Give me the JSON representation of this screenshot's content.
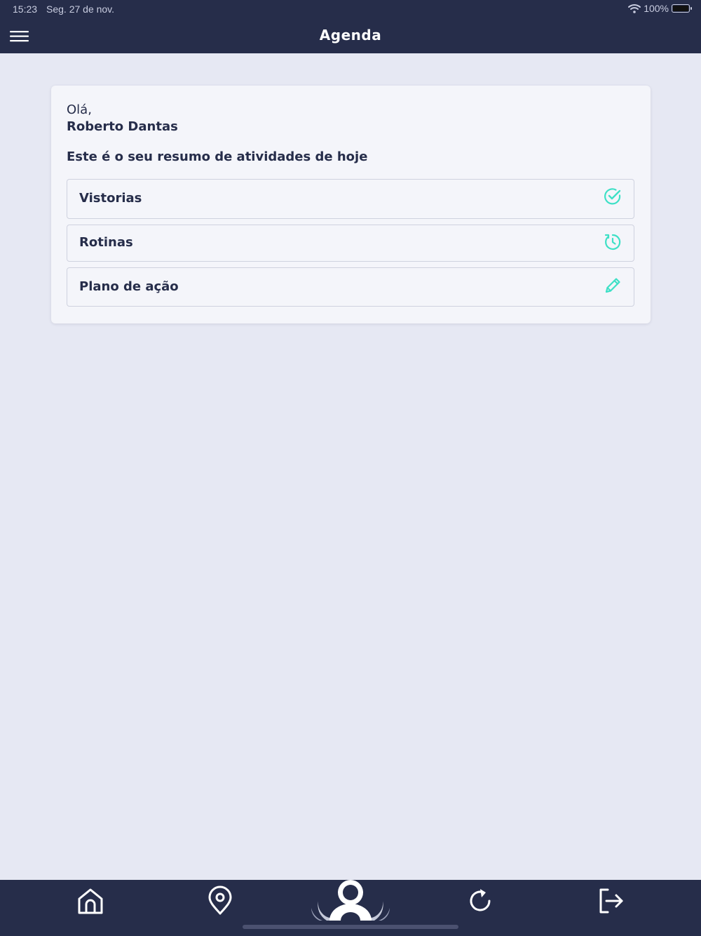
{
  "status_bar": {
    "time": "15:23",
    "date": "Seg. 27 de nov.",
    "battery": "100%"
  },
  "header": {
    "title": "Agenda"
  },
  "card": {
    "greeting": "Olá,",
    "user_name": "Roberto Dantas",
    "summary": "Este é o seu resumo de atividades de hoje",
    "items": [
      {
        "label": "Vistorias",
        "icon": "check-circle-icon"
      },
      {
        "label": "Rotinas",
        "icon": "clock-icon"
      },
      {
        "label": "Plano de ação",
        "icon": "pencil-icon"
      }
    ]
  },
  "bottom_nav": {
    "items": [
      "home-icon",
      "map-pin-icon",
      "profile-logo-icon",
      "refresh-icon",
      "logout-icon"
    ]
  },
  "colors": {
    "primary": "#262d4a",
    "accent": "#3ee0c6",
    "background": "#e6e8f3",
    "card": "#f4f5fa"
  }
}
